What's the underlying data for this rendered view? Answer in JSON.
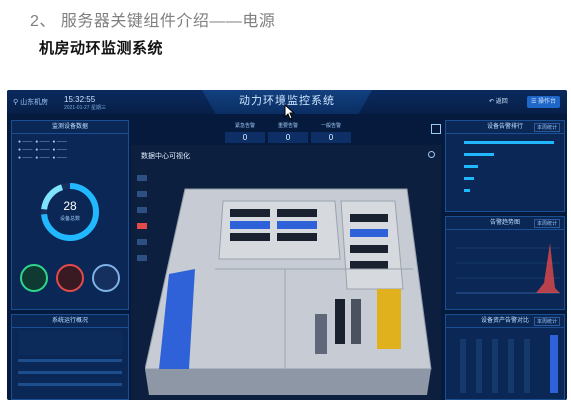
{
  "slide": {
    "title": "2、 服务器关键组件介绍——电源",
    "subtitle": "机房动环监测系统"
  },
  "screenshot": {
    "location": "山东机房",
    "time": "15:32:55",
    "date": "2021-01-27 星期三",
    "system_title": "动力环境监控系统",
    "back_label": "返回",
    "ops_label": "操作台",
    "stats": [
      {
        "label": "紧急告警",
        "value": "0"
      },
      {
        "label": "重要告警",
        "value": "0"
      },
      {
        "label": "一般告警",
        "value": "0"
      }
    ],
    "left_panel_title": "监测设备数据",
    "device_count": "28",
    "device_count_label": "设备总数",
    "left_bottom_title": "系统运行概况",
    "dc_title": "数据中心可视化",
    "right_top_title": "设备告警排行",
    "right_mid_title": "告警趋势图",
    "right_bottom_title": "设备资产告警对比",
    "tag_label": "本周统计",
    "colors": {
      "background": "#061a3d",
      "accent": "#22b8ff",
      "alarm_red": "#e34a4a",
      "rack_blue": "#2f62d8",
      "rack_yellow": "#e0b11d"
    }
  }
}
